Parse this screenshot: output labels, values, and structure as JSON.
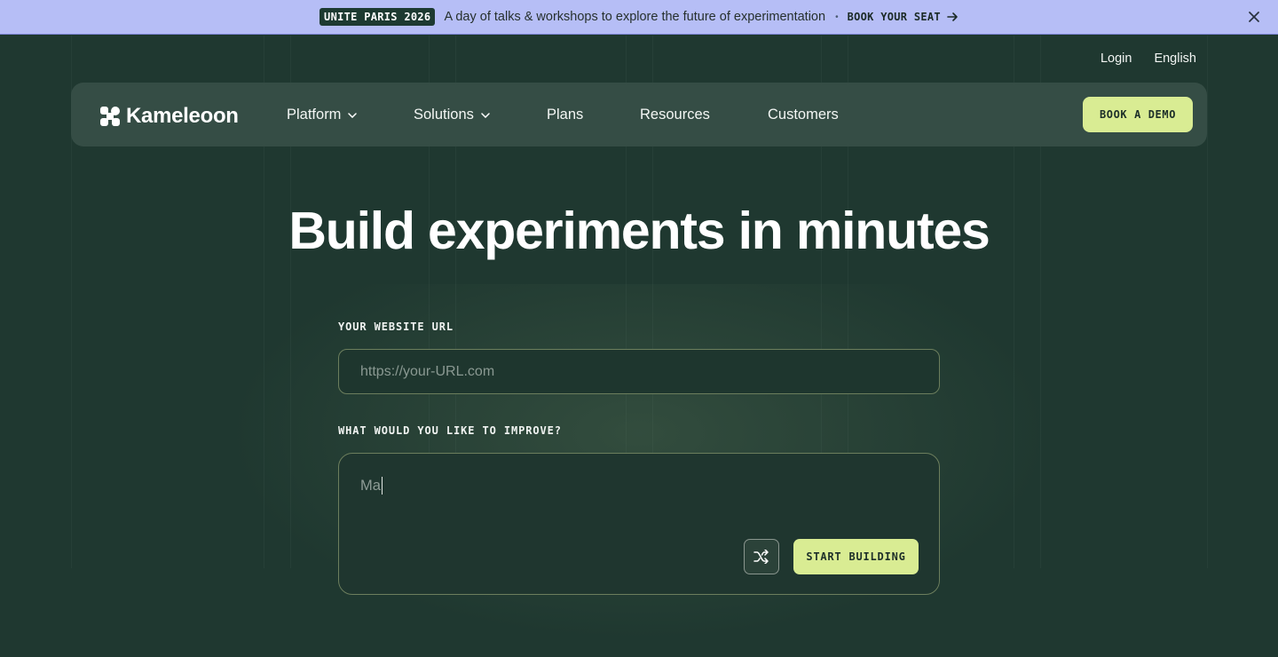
{
  "announcement": {
    "tag": "UNITE PARIS 2026",
    "message": "A day of talks & workshops to explore the future of experimentation",
    "separator": "•",
    "cta": "BOOK YOUR SEAT"
  },
  "utility": {
    "login": "Login",
    "language": "English"
  },
  "nav": {
    "logo": "Kameleoon",
    "items": [
      {
        "label": "Platform",
        "has_dropdown": true
      },
      {
        "label": "Solutions",
        "has_dropdown": true
      },
      {
        "label": "Plans",
        "has_dropdown": false
      },
      {
        "label": "Resources",
        "has_dropdown": false
      },
      {
        "label": "Customers",
        "has_dropdown": false
      }
    ],
    "demo_button": "BOOK A DEMO"
  },
  "hero": {
    "title": "Build experiments in minutes",
    "url_label": "YOUR WEBSITE URL",
    "url_placeholder": "https://your-URL.com",
    "improve_label": "WHAT WOULD YOU LIKE TO IMPROVE?",
    "improve_value": "Ma",
    "start_button": "START BUILDING"
  },
  "colors": {
    "background": "#1f3830",
    "announcement_bar": "#b6bef6",
    "nav_bar": "#354d45",
    "accent": "#d9ec93"
  },
  "icons": [
    "arrow-right-icon",
    "close-icon",
    "kameleoon-logo-icon",
    "chevron-down-icon",
    "shuffle-icon"
  ]
}
